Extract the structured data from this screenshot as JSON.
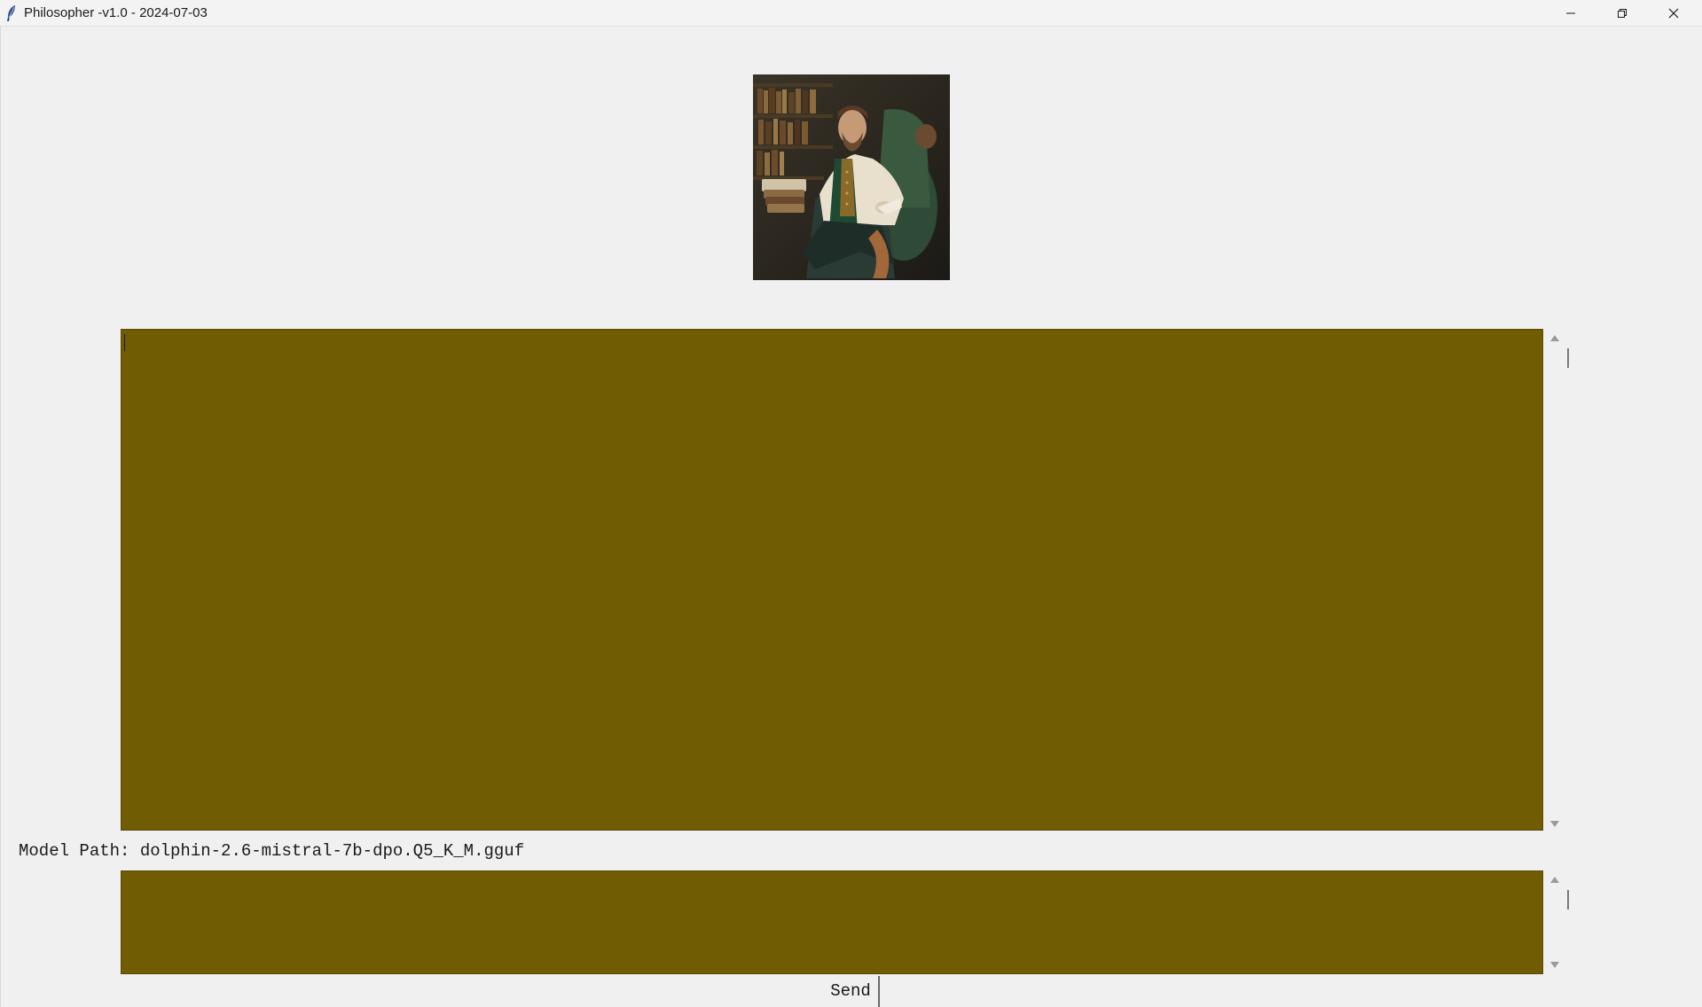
{
  "window": {
    "title": "Philosopher -v1.0 - 2024-07-03",
    "app_icon": "feather-icon",
    "controls": [
      "minimize-icon",
      "restore-icon",
      "close-icon"
    ]
  },
  "portrait": {
    "icon": "philosopher-portrait"
  },
  "chat": {
    "text": "",
    "background": "#705c03"
  },
  "model": {
    "label": "Model Path: dolphin-2.6-mistral-7b-dpo.Q5_K_M.gguf"
  },
  "input": {
    "text": "",
    "background": "#705c03"
  },
  "send": {
    "label": "Send"
  }
}
